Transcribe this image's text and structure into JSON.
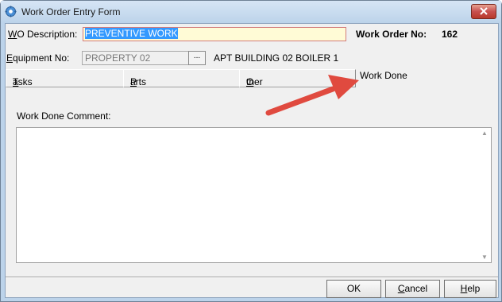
{
  "window": {
    "title": "Work Order Entry Form",
    "close_icon": "close-icon",
    "app_icon": "gear-icon"
  },
  "header": {
    "wo_description_label_u": "W",
    "wo_description_label_rest": "O Description:",
    "wo_description_value": "PREVENTIVE WORK",
    "work_order_label": "Work Order  No:",
    "work_order_number": "162"
  },
  "equipment": {
    "label_u": "E",
    "label_rest": "quipment No:",
    "value": "PROPERTY 02",
    "browse_label": "...",
    "description": "APT BUILDING 02 BOILER 1"
  },
  "tabs": [
    {
      "u": "T",
      "rest": "asks"
    },
    {
      "u": "P",
      "rest": "arts"
    },
    {
      "u": "O",
      "rest": "ther"
    },
    {
      "u": "",
      "rest": "Work Done"
    }
  ],
  "work_done": {
    "comment_label": "Work Done Comment:",
    "comment_value": ""
  },
  "buttons": {
    "ok": "OK",
    "cancel_u": "C",
    "cancel_rest": "ancel",
    "help_u": "H",
    "help_rest": "elp"
  },
  "annotation": {
    "arrow_color": "#e04a3f"
  }
}
